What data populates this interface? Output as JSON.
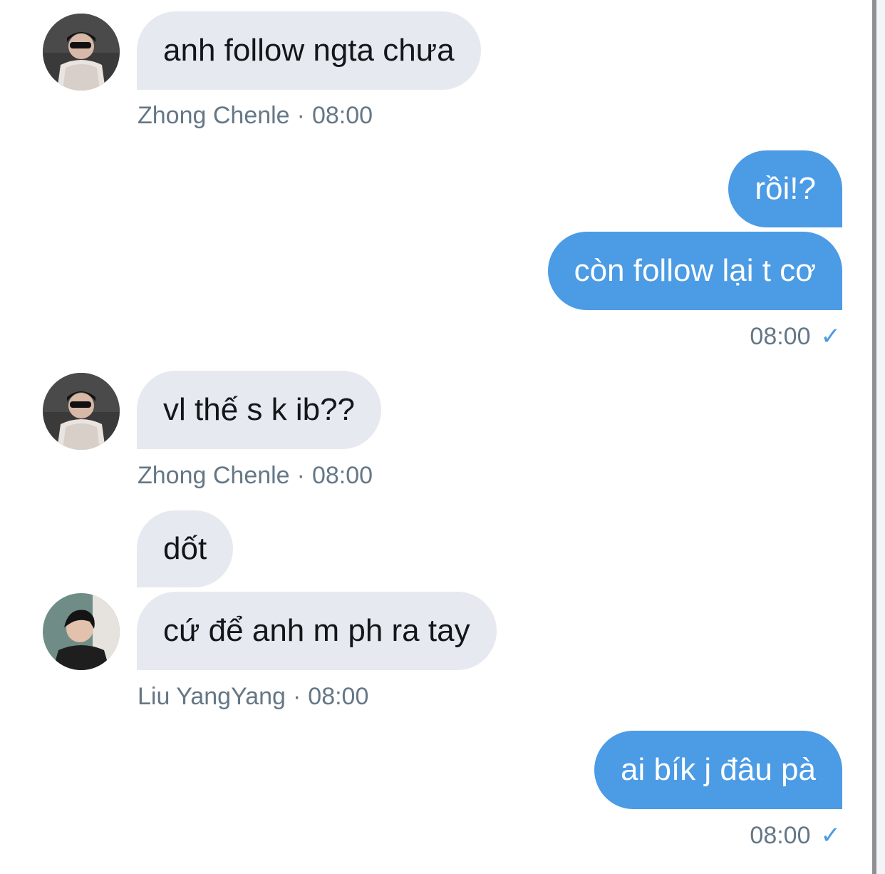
{
  "messages": [
    {
      "text": "anh follow ngta chưa",
      "sender": "Zhong Chenle",
      "time": "08:00",
      "direction": "incoming"
    },
    {
      "text": "rồi!?",
      "direction": "outgoing"
    },
    {
      "text": "còn follow lại t cơ",
      "time": "08:00",
      "direction": "outgoing",
      "status": "sent-check"
    },
    {
      "text": "vl thế s k ib??",
      "sender": "Zhong Chenle",
      "time": "08:00",
      "direction": "incoming"
    },
    {
      "text": "dốt",
      "direction": "incoming"
    },
    {
      "text": "cứ để anh m ph ra tay",
      "sender": "Liu YangYang",
      "time": "08:00",
      "direction": "incoming"
    },
    {
      "text": "ai bík j đâu pà",
      "time": "08:00",
      "direction": "outgoing",
      "status": "sent-check"
    }
  ],
  "meta": {
    "separator": "·",
    "check": "✓"
  },
  "colors": {
    "incoming_bubble": "#e6e9ef",
    "outgoing_bubble": "#4b9be5",
    "meta_text": "#657786"
  }
}
